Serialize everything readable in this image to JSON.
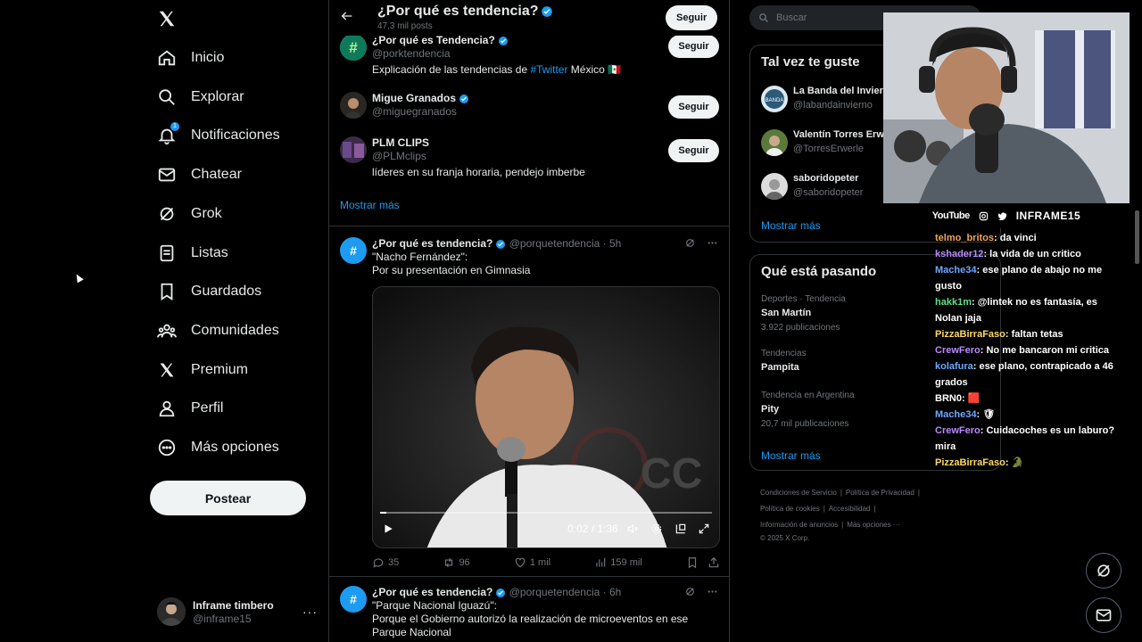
{
  "sidebar": {
    "items": [
      {
        "label": "Inicio",
        "icon": "home-icon"
      },
      {
        "label": "Explorar",
        "icon": "search-icon"
      },
      {
        "label": "Notificaciones",
        "icon": "bell-icon",
        "badge": "1"
      },
      {
        "label": "Chatear",
        "icon": "mail-icon"
      },
      {
        "label": "Grok",
        "icon": "grok-icon"
      },
      {
        "label": "Listas",
        "icon": "list-icon"
      },
      {
        "label": "Guardados",
        "icon": "bookmark-icon"
      },
      {
        "label": "Comunidades",
        "icon": "communities-icon"
      },
      {
        "label": "Premium",
        "icon": "x-icon"
      },
      {
        "label": "Perfil",
        "icon": "person-icon"
      },
      {
        "label": "Más opciones",
        "icon": "more-circle-icon"
      }
    ],
    "post_label": "Postear",
    "account": {
      "name": "Inframe timbero",
      "handle": "@inframe15",
      "more": "···"
    }
  },
  "header": {
    "title": "¿Por qué es tendencia?",
    "subtitle": "47,3 mil posts",
    "follow_label": "Seguir"
  },
  "who_to_follow_main": [
    {
      "name": "¿Por qué es Tendencia?",
      "handle": "@porktendencia",
      "bio_pre": "Explicación de las tendencias de ",
      "bio_link": "#Twitter",
      "bio_post": " México 🇲🇽",
      "follow": "Seguir",
      "verified": true
    },
    {
      "name": "Migue Granados",
      "handle": "@miguegranados",
      "bio": "",
      "follow": "Seguir",
      "verified": true
    },
    {
      "name": "PLM CLIPS",
      "handle": "@PLMclips",
      "bio": "líderes en su franja horaria, pendejo imberbe",
      "follow": "Seguir",
      "verified": false
    }
  ],
  "show_more": "Mostrar más",
  "tweets": [
    {
      "name": "¿Por qué es tendencia?",
      "handle": "@porquetendencia",
      "time": "· 5h",
      "line1": "\"Nacho Fernández\":",
      "line2": "Por su presentación en Gimnasia",
      "video_time": "0:02 / 1:36",
      "video_progress": 0.02,
      "replies": "35",
      "retweets": "96",
      "likes": "1 mil",
      "views": "159 mil"
    },
    {
      "name": "¿Por qué es tendencia?",
      "handle": "@porquetendencia",
      "time": "· 6h",
      "line1": "\"Parque Nacional Iguazú\":",
      "line2": "Porque el Gobierno autorizó la realización de microeventos en ese Parque Nacional"
    }
  ],
  "right": {
    "search_placeholder": "Buscar",
    "wtf_title": "Tal vez te guste",
    "wtf": [
      {
        "name": "La Banda del Invierno",
        "handle": "@labandainvierno"
      },
      {
        "name": "Valentín Torres Erwerle",
        "handle": "@TorresErwerle"
      },
      {
        "name": "saboridopeter",
        "handle": "@saboridopeter"
      }
    ],
    "wtf_more": "Mostrar más",
    "trends_title": "Qué está pasando",
    "trends": [
      {
        "cat": "Deportes · Tendencia",
        "name": "San Martín",
        "count": "3.922 publicaciones"
      },
      {
        "cat": "Tendencias",
        "name": "Pampita",
        "count": ""
      },
      {
        "cat": "Tendencia en Argentina",
        "name": "Pity",
        "count": "20,7 mil publicaciones"
      }
    ],
    "trends_more": "Mostrar más",
    "footer": [
      "Condiciones de Servicio",
      "|",
      "Política de Privacidad",
      "|",
      "Política de cookies",
      "|",
      "Accesibilidad",
      "|",
      "Información de anuncios",
      "|",
      "Más opciones ···",
      "© 2025 X Corp."
    ]
  },
  "stream": {
    "youtube": "YouTube",
    "channel": "INFRAME15",
    "chat": [
      {
        "user": "telmo_britos",
        "color": "#f0a35e",
        "text": ": da vinci"
      },
      {
        "user": "kshader12",
        "color": "#b98bff",
        "text": ": la vida de un critico"
      },
      {
        "user": "Mache34",
        "color": "#6fa8ff",
        "text": ": ese plano de abajo no me gusto"
      },
      {
        "user": "hakk1m",
        "color": "#5ee08a",
        "text": ": @lintek no es fantasía, es Nolan jaja"
      },
      {
        "user": "PizzaBirraFaso",
        "color": "#ffd966",
        "text": ": faltan tetas"
      },
      {
        "user": "CrewFero",
        "color": "#b98bff",
        "text": ": No me bancaron mi critica"
      },
      {
        "user": "kolafura",
        "color": "#6fa8ff",
        "text": ": ese plano, contrapicado a 46 grados"
      },
      {
        "user": "BRN0",
        "color": "#ffffff",
        "text": ": 🟥"
      },
      {
        "user": "Mache34",
        "color": "#6fa8ff",
        "text": ": 🛡"
      },
      {
        "user": "CrewFero",
        "color": "#b98bff",
        "text": ": Cuidacoches es un laburo? mira"
      },
      {
        "user": "PizzaBirraFaso",
        "color": "#ffd966",
        "text": ": 🐊"
      }
    ]
  }
}
